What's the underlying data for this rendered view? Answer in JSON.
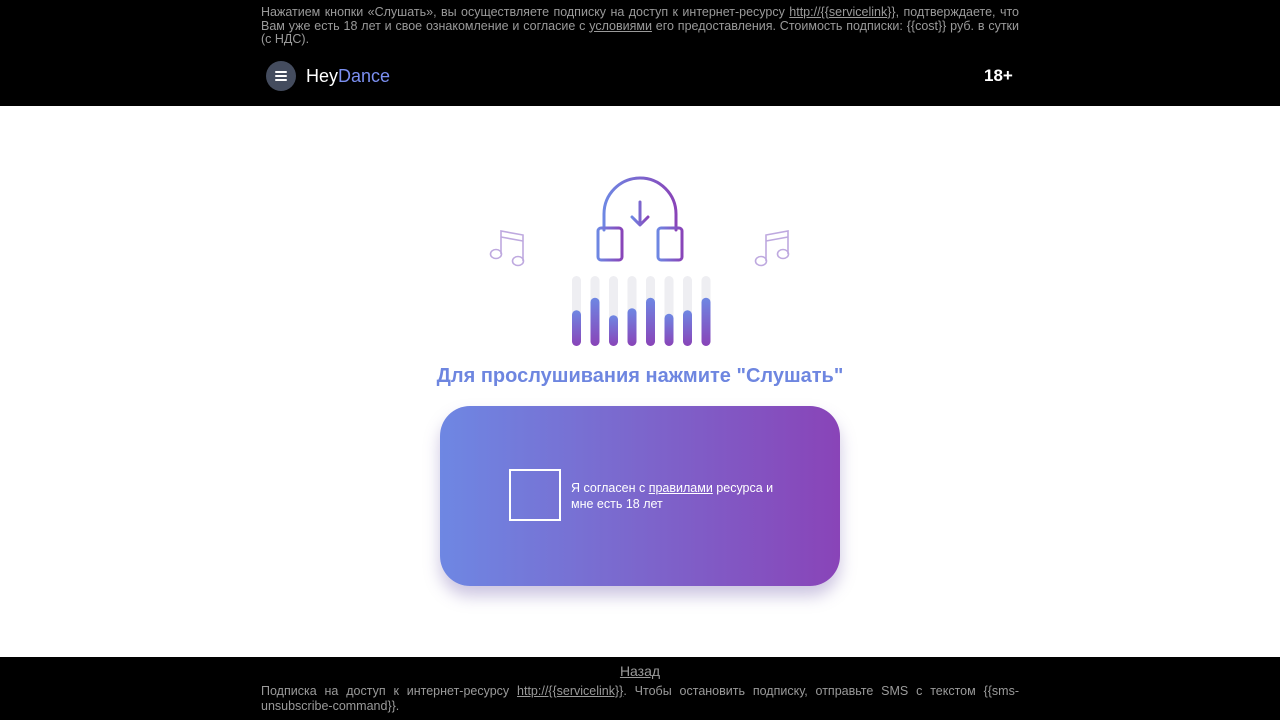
{
  "header": {
    "disclaimer": {
      "part1": "Нажатием кнопки «Слушать», вы осуществляете подписку на доступ к интернет-ресурсу ",
      "link1": "http://{{servicelink}}",
      "part2": ", подтверждаете, что Вам уже есть 18 лет и свое ознакомление и согласие с ",
      "link2": "условиями",
      "part3": " его предоставления. Стоимость подписки: {{cost}} руб. в сутки (с НДС)."
    },
    "menu_icon": "hamburger-menu-icon",
    "logo_part1": "Hey",
    "logo_part2": "Dance",
    "age_rating": "18+"
  },
  "main": {
    "illustration_icons": [
      "headphones-download-icon",
      "music-note-icon",
      "equalizer-icon"
    ],
    "equalizer_levels": [
      0.51,
      0.69,
      0.44,
      0.54,
      0.69,
      0.46,
      0.51,
      0.69
    ],
    "call_to_action": "Для прослушивания нажмите \"Слушать\"",
    "agree": {
      "text_before": "Я согласен с ",
      "link": "правилами",
      "text_after": " ресурса и мне есть 18 лет",
      "checked": false
    }
  },
  "footer": {
    "back_label": "Назад",
    "text_part1": "Подписка на доступ к интернет-ресурсу ",
    "text_link": "http://{{servicelink}}",
    "text_part2": ". Чтобы остановить подписку, отправьте SMS с текстом {{sms-unsubscribe-command}}."
  },
  "colors": {
    "header_bg": "#000000",
    "accent_blue": "#6e86e0",
    "accent_purple": "#8944b8",
    "muted_text": "#9a9a9a"
  }
}
